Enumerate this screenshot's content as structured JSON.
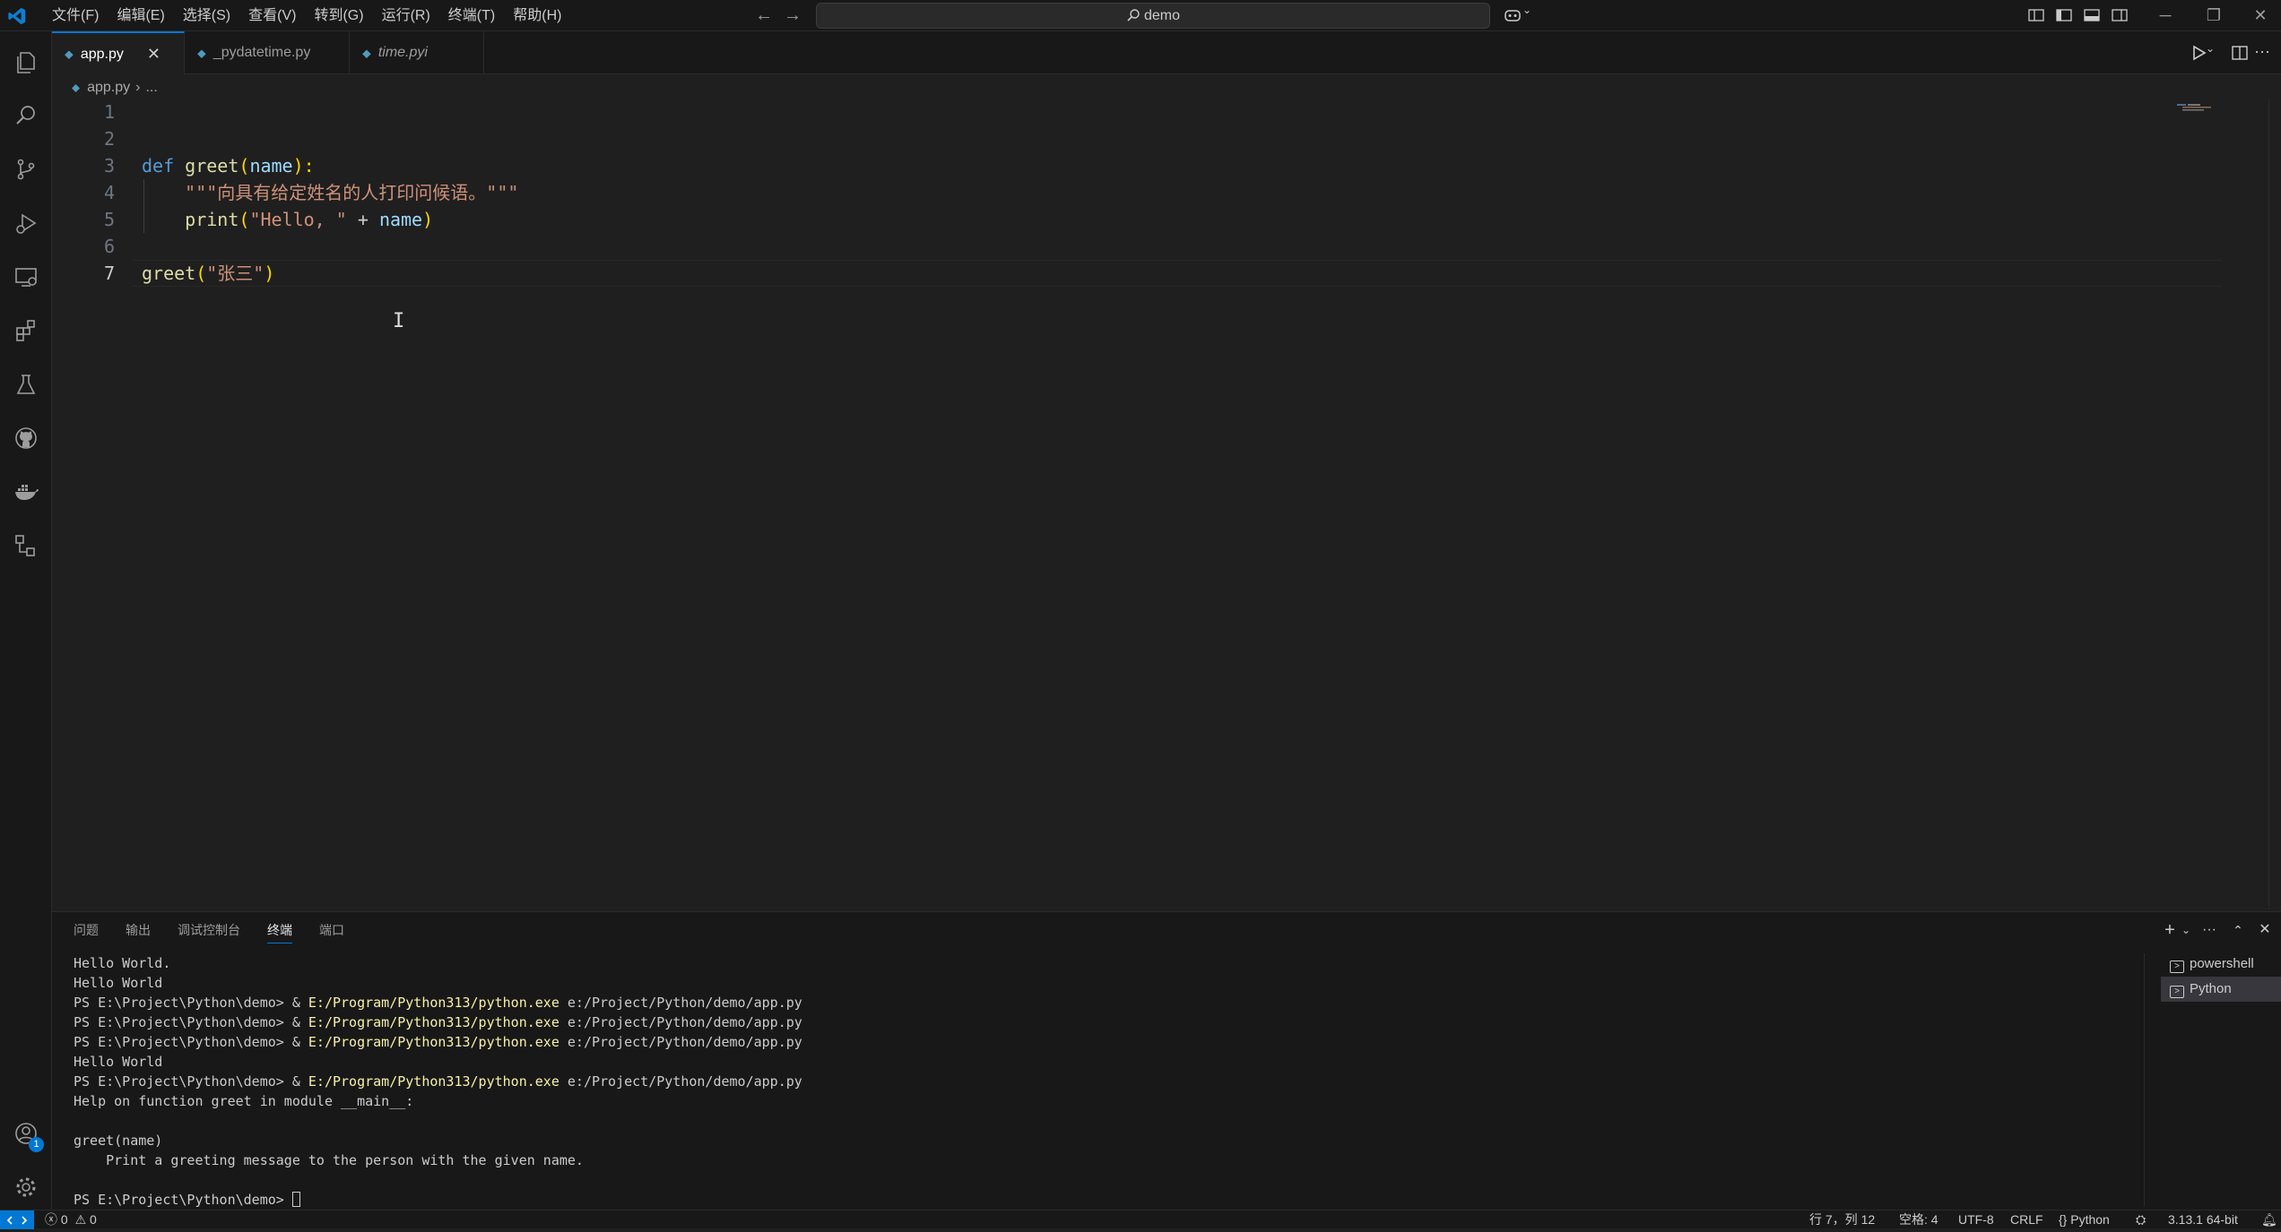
{
  "menu": [
    "文件(F)",
    "编辑(E)",
    "选择(S)",
    "查看(V)",
    "转到(G)",
    "运行(R)",
    "终端(T)",
    "帮助(H)"
  ],
  "search": {
    "text": "demo"
  },
  "tabs": [
    {
      "label": "app.py",
      "active": true
    },
    {
      "label": "_pydatetime.py",
      "active": false
    },
    {
      "label": "time.pyi",
      "active": false
    }
  ],
  "breadcrumb": {
    "file": "app.py",
    "rest": "..."
  },
  "editor": {
    "line_numbers": [
      "1",
      "2",
      "3",
      "4",
      "5",
      "6",
      "7"
    ],
    "lines": {
      "l3_kw": "def",
      "l3_fn": "greet",
      "l3_open": "(",
      "l3_param": "name",
      "l3_close": "):",
      "l4_doc": "\"\"\"向具有给定姓名的人打印问候语。\"\"\"",
      "l5_fn": "print",
      "l5_open": "(",
      "l5_str": "\"Hello, \"",
      "l5_op": " + ",
      "l5_var": "name",
      "l5_close": ")",
      "l7_fn": "greet",
      "l7_open": "(",
      "l7_str": "\"张三\"",
      "l7_close": ")"
    }
  },
  "panel": {
    "tabs": [
      "问题",
      "输出",
      "调试控制台",
      "终端",
      "端口"
    ],
    "active_tab": "终端"
  },
  "terminal": {
    "l1": "Hello World.",
    "l2": "Hello World",
    "prompt": "PS E:\\Project\\Python\\demo> & ",
    "exe": "E:/Program/Python313/python.exe",
    "arg": " e:/Project/Python/demo/app.py",
    "l6": "Hello World",
    "l8": "Help on function greet in module __main__:",
    "l10": "greet(name)",
    "l11": "    Print a greeting message to the person with the given name.",
    "last_prompt": "PS E:\\Project\\Python\\demo> "
  },
  "terminal_list": [
    "powershell",
    "Python"
  ],
  "statusbar": {
    "problems": "0",
    "warnings": "0",
    "position": "行 7，列 12",
    "spaces": "空格: 4",
    "encoding": "UTF-8",
    "eol": "CRLF",
    "language": "Python",
    "interpreter": "3.13.1 64-bit"
  },
  "account_badge": "1",
  "colors": {
    "accent": "#0078d4",
    "keyword": "#569cd6",
    "function": "#dcdcaa",
    "string": "#ce9178",
    "parameter": "#9cdcfe",
    "bracket": "#ffd700"
  }
}
